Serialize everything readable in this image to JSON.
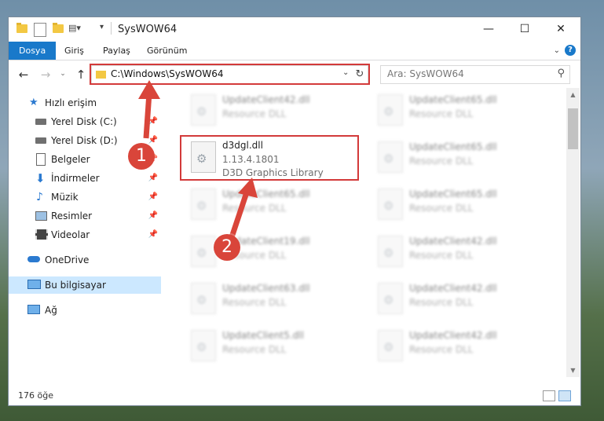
{
  "window": {
    "title": "SysWOW64",
    "minimize": "—",
    "maximize": "☐",
    "close": "✕"
  },
  "ribbon": {
    "tabs": [
      "Dosya",
      "Giriş",
      "Paylaş",
      "Görünüm"
    ],
    "help": "?"
  },
  "address": {
    "path": "C:\\Windows\\SysWOW64",
    "search_placeholder": "Ara: SysWOW64"
  },
  "navpane": {
    "quick_access": "Hızlı erişim",
    "items": [
      {
        "label": "Yerel Disk (C:)",
        "icon": "drive-icon"
      },
      {
        "label": "Yerel Disk (D:)",
        "icon": "drive-icon"
      },
      {
        "label": "Belgeler",
        "icon": "documents-icon"
      },
      {
        "label": "İndirmeler",
        "icon": "downloads-icon"
      },
      {
        "label": "Müzik",
        "icon": "music-icon"
      },
      {
        "label": "Resimler",
        "icon": "pictures-icon"
      },
      {
        "label": "Videolar",
        "icon": "videos-icon"
      }
    ],
    "onedrive": "OneDrive",
    "this_pc": "Bu bilgisayar",
    "network": "Ağ"
  },
  "highlighted_file": {
    "name": "d3dgl.dll",
    "version": "1.13.4.1801",
    "description": "D3D Graphics Library"
  },
  "blurred_files": [
    {
      "name": "UpdateClient42.dll",
      "desc": "Resource DLL"
    },
    {
      "name": "UpdateClient65.dll",
      "desc": "Resource DLL"
    },
    {
      "name": "UpdateClient65.dll",
      "desc": "Resource DLL"
    },
    {
      "name": "UpdateClient65.dll",
      "desc": "Resource DLL"
    },
    {
      "name": "UpdateClient65.dll",
      "desc": "Resource DLL"
    },
    {
      "name": "UpdateClient19.dll",
      "desc": "Resource DLL"
    },
    {
      "name": "UpdateClient42.dll",
      "desc": "Resource DLL"
    },
    {
      "name": "UpdateClient63.dll",
      "desc": "Resource DLL"
    },
    {
      "name": "UpdateClient42.dll",
      "desc": "Resource DLL"
    },
    {
      "name": "UpdateClient5.dll",
      "desc": "Resource DLL"
    },
    {
      "name": "UpdateClient42.dll",
      "desc": "Resource DLL"
    }
  ],
  "status": {
    "count": "176 öğe"
  },
  "markers": [
    "1",
    "2"
  ],
  "colors": {
    "accent": "#1979ca",
    "highlight_box": "#d33a3a",
    "marker": "#d9453a",
    "selected": "#cce8ff"
  }
}
